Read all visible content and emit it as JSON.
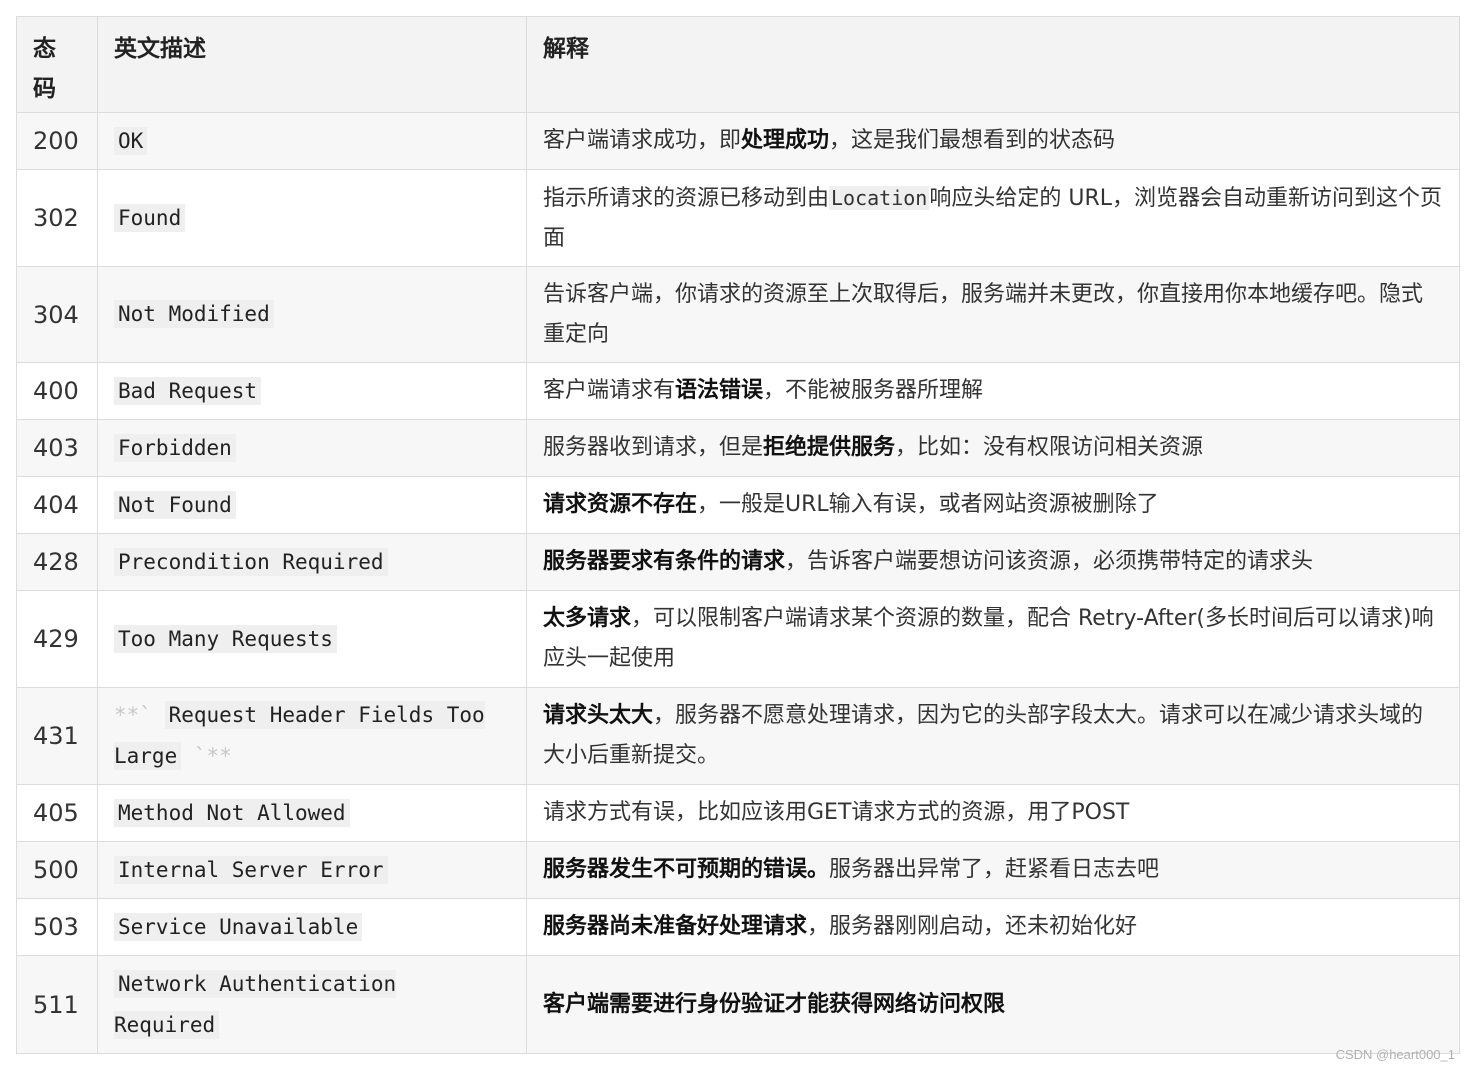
{
  "headers": {
    "code": "态码",
    "name": "英文描述",
    "desc": "解释"
  },
  "rows": [
    {
      "code": "200",
      "name": "OK",
      "desc": [
        {
          "t": "客户端请求成功，即"
        },
        {
          "t": "处理成功",
          "b": true
        },
        {
          "t": "，这是我们最想看到的状态码"
        }
      ]
    },
    {
      "code": "302",
      "name": "Found",
      "desc": [
        {
          "t": "指示所请求的资源已移动到由"
        },
        {
          "t": "Location",
          "m": true
        },
        {
          "t": "响应头给定的 URL，浏览器会自动重新访问到这个页面"
        }
      ]
    },
    {
      "code": "304",
      "name": "Not Modified",
      "desc": [
        {
          "t": "告诉客户端，你请求的资源至上次取得后，服务端并未更改，你直接用你本地缓存吧。隐式重定向"
        }
      ]
    },
    {
      "code": "400",
      "name": "Bad Request",
      "desc": [
        {
          "t": "客户端请求有"
        },
        {
          "t": "语法错误",
          "b": true
        },
        {
          "t": "，不能被服务器所理解"
        }
      ]
    },
    {
      "code": "403",
      "name": "Forbidden",
      "desc": [
        {
          "t": "服务器收到请求，但是"
        },
        {
          "t": "拒绝提供服务",
          "b": true
        },
        {
          "t": "，比如：没有权限访问相关资源"
        }
      ]
    },
    {
      "code": "404",
      "name": "Not Found",
      "desc": [
        {
          "t": "请求资源不存在",
          "b": true
        },
        {
          "t": "，一般是URL输入有误，或者网站资源被删除了"
        }
      ]
    },
    {
      "code": "428",
      "name": "Precondition Required",
      "desc": [
        {
          "t": "服务器要求有条件的请求",
          "b": true
        },
        {
          "t": "，告诉客户端要想访问该资源，必须携带特定的请求头"
        }
      ]
    },
    {
      "code": "429",
      "name": "Too Many Requests",
      "desc": [
        {
          "t": "太多请求",
          "b": true
        },
        {
          "t": "，可以限制客户端请求某个资源的数量，配合 Retry-After(多长时间后可以请求)响应头一起使用"
        }
      ]
    },
    {
      "code": "431",
      "name_prefix": "**`",
      "name": "Request Header Fields Too Large",
      "name_suffix": "`**",
      "desc": [
        {
          "t": "请求头太大",
          "b": true
        },
        {
          "t": "，服务器不愿意处理请求，因为它的头部字段太大。请求可以在减少请求头域的大小后重新提交。"
        }
      ]
    },
    {
      "code": "405",
      "name": "Method Not Allowed",
      "desc": [
        {
          "t": "请求方式有误，比如应该用GET请求方式的资源，用了POST"
        }
      ]
    },
    {
      "code": "500",
      "name": "Internal Server Error",
      "desc": [
        {
          "t": "服务器发生不可预期的错误。",
          "b": true
        },
        {
          "t": "服务器出异常了，赶紧看日志去吧"
        }
      ]
    },
    {
      "code": "503",
      "name": "Service Unavailable",
      "desc": [
        {
          "t": "服务器尚未准备好处理请求",
          "b": true
        },
        {
          "t": "，服务器刚刚启动，还未初始化好"
        }
      ]
    },
    {
      "code": "511",
      "name": "Network Authentication Required",
      "desc": [
        {
          "t": "客户端需要进行身份验证才能获得网络访问权限",
          "b": true
        }
      ]
    }
  ],
  "footer": "CSDN @heart000_1"
}
